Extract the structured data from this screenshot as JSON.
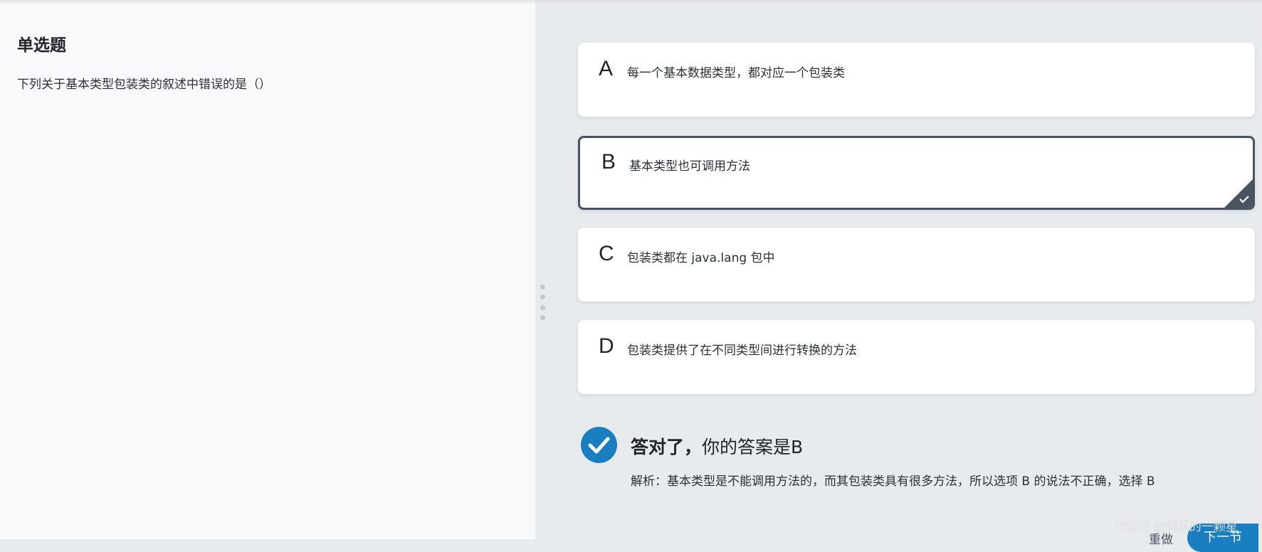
{
  "question": {
    "type_label": "单选题",
    "text": "下列关于基本类型包装类的叙述中错误的是（）"
  },
  "options": [
    {
      "letter": "A",
      "text": "每一个基本数据类型，都对应一个包装类"
    },
    {
      "letter": "B",
      "text": "基本类型也可调用方法",
      "selected": true
    },
    {
      "letter": "C",
      "text": "包装类都在 java.lang 包中"
    },
    {
      "letter": "D",
      "text": "包装类提供了在不同类型间进行转换的方法"
    }
  ],
  "result": {
    "title_strong": "答对了，",
    "title_rest": "你的答案是B",
    "explanation": "解析：基本类型是不能调用方法的，而其包装类具有很多方法，所以选项 B 的说法不正确，选择 B"
  },
  "footer": {
    "redo_label": "重做",
    "next_label": "下一节"
  },
  "watermark": "CSDN @快乐的一颗星",
  "colors": {
    "accent": "#1a7fc1",
    "selected_border": "#4a5461",
    "left_bg": "#f7f9fb",
    "right_bg": "#e8ebee"
  },
  "icons": {
    "selected_check": "checkmark-icon",
    "result": "check-circle-icon",
    "splitter": "vertical-dots-icon"
  }
}
